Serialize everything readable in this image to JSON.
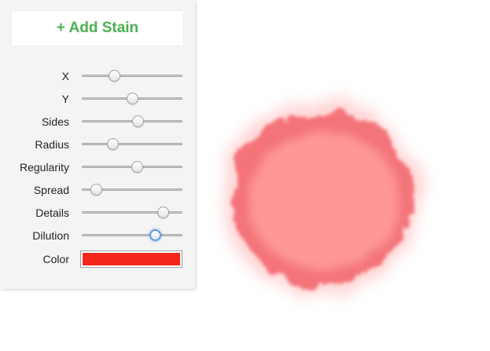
{
  "controls": {
    "add_button_label": "+ Add Stain",
    "sliders": [
      {
        "label": "X",
        "value": 0.3
      },
      {
        "label": "Y",
        "value": 0.5
      },
      {
        "label": "Sides",
        "value": 0.56
      },
      {
        "label": "Radius",
        "value": 0.28
      },
      {
        "label": "Regularity",
        "value": 0.55
      },
      {
        "label": "Spread",
        "value": 0.1
      },
      {
        "label": "Details",
        "value": 0.84
      },
      {
        "label": "Dilution",
        "value": 0.75
      }
    ],
    "color": {
      "label": "Color",
      "value": "#f3261a"
    }
  },
  "colors": {
    "accent_green": "#4caf50",
    "stain_fill": "#ff9a98",
    "stain_edge": "#f2636a"
  },
  "icons": {
    "add": "plus-glyph"
  }
}
